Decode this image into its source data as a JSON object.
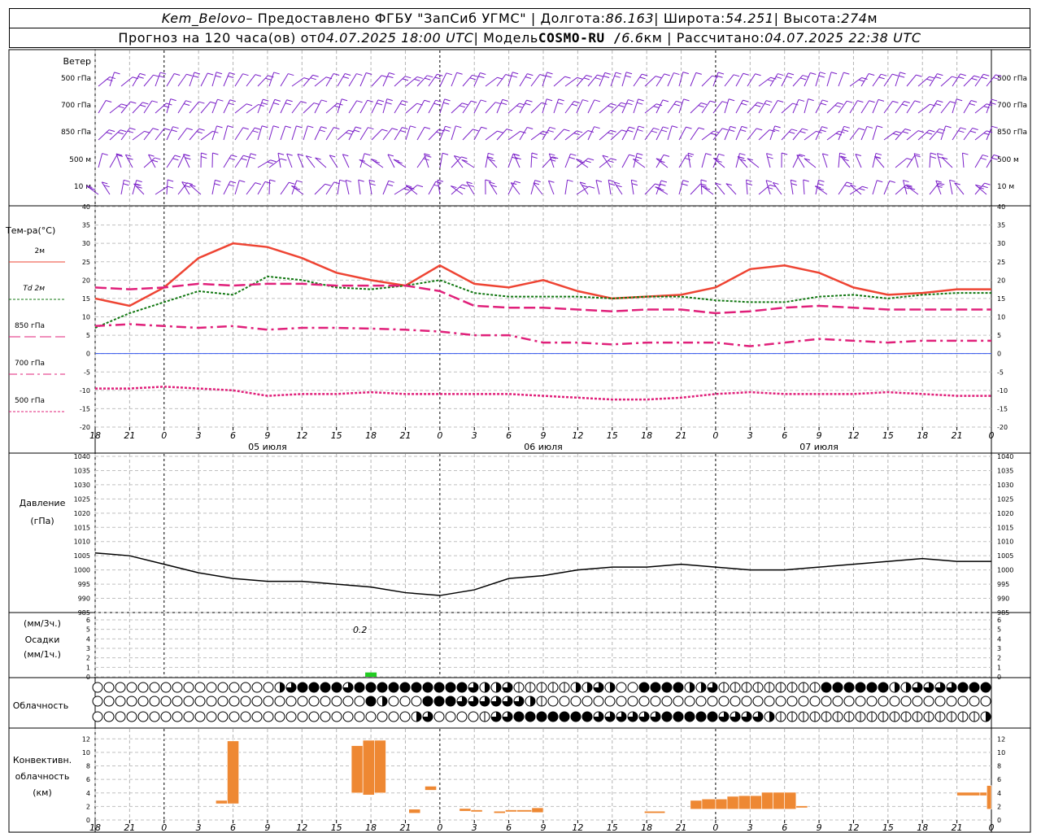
{
  "header": {
    "row1": {
      "station": "Kem_Belovo",
      "provided_by": " – Предоставлено ФГБУ \"ЗапСиб УГМС\" | Долгота: ",
      "lon": "86.163",
      "lat_label": " | Широта: ",
      "lat": "54.251",
      "alt_label": " | Высота: ",
      "alt": "274",
      "alt_unit": "м"
    },
    "row2": {
      "forecast_label": "Прогноз на 120 часа(ов) от ",
      "forecast_from": "04.07.2025 18:00 UTC",
      "model_label": "  | Модель ",
      "model_name": "COSMO-RU / ",
      "model_res": "6.6",
      "model_unit": "км | Рассчитано: ",
      "computed": "04.07.2025 22:38 UTC"
    }
  },
  "chart_data": [
    {
      "type": "wind-barbs",
      "title": "Ветер",
      "levels": [
        "500 гПа",
        "700 гПа",
        "850 гПа",
        "500 м",
        "10 м"
      ],
      "color": "#7a1fc8"
    },
    {
      "type": "line",
      "ylabel": "Тем-ра(°C)",
      "ylim": [
        -20,
        40
      ],
      "yticks": [
        -20,
        -15,
        -10,
        -5,
        0,
        5,
        10,
        15,
        20,
        25,
        30,
        35,
        40
      ],
      "legend": [
        {
          "label": "2м",
          "color": "#ee4433"
        },
        {
          "label": "Td  2м",
          "color": "#117711"
        },
        {
          "label": "850 гПа",
          "color": "#e0207a"
        },
        {
          "label": "700 гПа",
          "color": "#e0207a"
        },
        {
          "label": "500 гПа",
          "color": "#e0207a"
        }
      ],
      "x_hours": [
        0,
        3,
        6,
        9,
        12,
        15,
        18,
        21,
        24,
        27,
        30,
        33,
        36,
        39,
        42,
        45,
        48,
        51,
        54,
        57,
        60,
        63,
        66,
        69,
        72,
        75,
        78
      ],
      "series": [
        {
          "name": "2м",
          "color": "#ee4433",
          "values": [
            15,
            13,
            18,
            26,
            30,
            29,
            26,
            22,
            20,
            18.5,
            24,
            19,
            18,
            20,
            17,
            15,
            15.5,
            16,
            18,
            23,
            24,
            22,
            18,
            16,
            16.5,
            17.5,
            17.5
          ]
        },
        {
          "name": "Td  2м",
          "color": "#117711",
          "values": [
            7,
            11,
            14,
            17,
            16,
            21,
            20,
            18,
            17.5,
            18.5,
            20,
            16.5,
            15.5,
            15.5,
            15.5,
            15,
            15.5,
            15.5,
            14.5,
            14,
            14,
            15.5,
            16,
            15,
            16,
            16.5,
            16.5
          ]
        },
        {
          "name": "850 гПа",
          "color": "#e0207a",
          "values": [
            18,
            17.5,
            18,
            19,
            18.5,
            19,
            19,
            18.5,
            18.5,
            18.5,
            17,
            13,
            12.5,
            12.5,
            12,
            11.5,
            12,
            12,
            11,
            11.5,
            12.5,
            13,
            12.5,
            12,
            12,
            12,
            12
          ]
        },
        {
          "name": "700 гПа",
          "color": "#e0207a",
          "values": [
            7.5,
            8,
            7.5,
            7,
            7.5,
            6.5,
            7,
            7,
            6.8,
            6.5,
            6,
            5,
            5,
            3,
            3,
            2.5,
            3,
            3,
            3,
            2,
            3,
            4,
            3.5,
            3,
            3.5,
            3.5,
            3.5
          ]
        },
        {
          "name": "500 гПа",
          "color": "#e0207a",
          "values": [
            -9.5,
            -9.5,
            -9,
            -9.5,
            -10,
            -11.5,
            -11,
            -11,
            -10.5,
            -11,
            -11,
            -11,
            -11,
            -11.5,
            -12,
            -12.5,
            -12.5,
            -12,
            -11,
            -10.5,
            -11,
            -11,
            -11,
            -10.5,
            -11,
            -11.5,
            -11.5
          ]
        }
      ]
    },
    {
      "type": "line",
      "ylabel": "Давление",
      "yunit": "(гПа)",
      "ylim": [
        985,
        1040
      ],
      "yticks": [
        985,
        990,
        995,
        1000,
        1005,
        1010,
        1015,
        1020,
        1025,
        1030,
        1035,
        1040
      ],
      "x_hours": [
        0,
        3,
        6,
        9,
        12,
        15,
        18,
        21,
        24,
        27,
        30,
        33,
        36,
        39,
        42,
        45,
        48,
        51,
        54,
        57,
        60,
        63,
        66,
        69,
        72,
        75,
        78
      ],
      "series": [
        {
          "name": "",
          "color": "#000000",
          "values": [
            1006,
            1005,
            1002,
            999,
            997,
            996,
            996,
            995,
            994,
            992,
            991,
            993,
            997,
            998,
            1000,
            1001,
            1001,
            1002,
            1001,
            1000,
            1000,
            1001,
            1002,
            1003,
            1004,
            1003,
            1003
          ]
        }
      ]
    },
    {
      "type": "bar",
      "ylabel_top": "(мм/3ч.)",
      "ylabel": "Осадки",
      "ylabel_bottom": "(мм/1ч.)",
      "ylim": [
        0,
        6
      ],
      "yticks": [
        0,
        1,
        2,
        3,
        4,
        5,
        6
      ],
      "annotation": "0.2",
      "bars": [
        {
          "hour": 24,
          "value": 0.2
        }
      ]
    },
    {
      "type": "table",
      "label": "Облачность",
      "rows": [
        "000000000000000000000000000000000000000000000000000000000000000000000000000000000000000000000000000000000000000000000000000000000000000000000000000000000000000000000000000000000000",
        "000000000000000000000000000000000000000000000000000000000000000000000000000000000000000000000000000000000000000000000000000000000000000000000000000000000000000000000000000000000000",
        "000000000000000000000000000000000000000000000000000000000000000000000000000000000000000000000000000000000000000000000000000000000000000000000000000000000000000000000000000000000000"
      ],
      "levels_hours": [
        [
          0,
          0,
          0,
          0,
          0,
          0,
          0,
          0,
          0,
          0,
          0,
          0,
          0,
          0,
          0,
          0,
          2,
          3,
          4,
          4,
          4,
          4,
          3,
          4,
          4,
          4,
          4,
          4,
          4,
          4,
          4,
          4,
          4,
          3,
          2,
          2,
          3,
          1,
          1,
          1,
          1,
          1,
          2,
          2,
          3,
          2,
          0,
          0,
          4,
          4,
          4,
          4,
          2,
          2,
          3,
          1,
          1,
          1,
          1,
          1,
          1,
          1,
          1,
          1,
          4,
          4,
          4,
          4,
          4,
          4,
          2,
          2,
          3,
          3,
          3,
          3,
          4,
          4,
          4,
          4,
          4,
          4,
          4,
          3,
          3,
          4,
          4
        ],
        [
          0,
          0,
          0,
          0,
          0,
          0,
          0,
          0,
          0,
          0,
          0,
          0,
          0,
          0,
          0,
          0,
          0,
          0,
          0,
          0,
          0,
          0,
          0,
          0,
          4,
          2,
          0,
          0,
          0,
          4,
          4,
          4,
          3,
          3,
          3,
          3,
          3,
          3,
          2,
          1,
          0,
          0,
          0,
          0,
          0,
          0,
          0,
          0,
          0,
          0,
          0,
          0,
          0,
          0,
          0,
          0,
          0,
          0,
          0,
          0,
          0,
          0,
          0,
          0,
          0,
          0,
          0,
          0,
          0,
          0,
          0,
          0,
          0,
          0,
          0,
          0,
          0,
          0,
          0,
          0,
          0,
          0,
          0,
          0,
          0,
          0,
          0
        ],
        [
          0,
          0,
          0,
          0,
          0,
          0,
          0,
          0,
          0,
          0,
          0,
          0,
          0,
          0,
          0,
          0,
          0,
          0,
          0,
          0,
          0,
          0,
          0,
          0,
          0,
          0,
          0,
          0,
          2,
          3,
          0,
          0,
          0,
          0,
          1,
          3,
          3,
          4,
          4,
          4,
          4,
          4,
          4,
          4,
          3,
          3,
          3,
          3,
          3,
          3,
          4,
          4,
          4,
          4,
          4,
          3,
          3,
          3,
          3,
          2,
          1,
          1,
          1,
          1,
          1,
          1,
          1,
          1,
          1,
          1,
          1,
          1,
          1,
          1,
          1,
          1,
          1,
          1,
          2,
          2,
          2,
          3,
          3,
          3,
          3,
          3,
          3
        ]
      ]
    },
    {
      "type": "bar",
      "ylabel_top": "Конвективн.",
      "ylabel": "облачность",
      "ylabel_bottom": "(км)",
      "ylim": [
        0,
        13
      ],
      "yticks": [
        0,
        2,
        4,
        6,
        8,
        10,
        12
      ],
      "ranges": [
        {
          "h0": 10.5,
          "h1": 11.5,
          "bottom": 2.4,
          "top": 2.9
        },
        {
          "h0": 11.5,
          "h1": 12.5,
          "bottom": 2.4,
          "top": 11.7
        },
        {
          "h0": 22.3,
          "h1": 23.3,
          "bottom": 4.0,
          "top": 11.0
        },
        {
          "h0": 23.3,
          "h1": 24.3,
          "bottom": 3.7,
          "top": 11.8
        },
        {
          "h0": 24.3,
          "h1": 25.3,
          "bottom": 4.0,
          "top": 11.8
        },
        {
          "h0": 27.3,
          "h1": 28.3,
          "bottom": 1.0,
          "top": 1.6
        },
        {
          "h0": 28.7,
          "h1": 29.7,
          "bottom": 4.4,
          "top": 5.0
        },
        {
          "h0": 31.7,
          "h1": 32.7,
          "bottom": 1.3,
          "top": 1.7
        },
        {
          "h0": 32.7,
          "h1": 33.7,
          "bottom": 1.2,
          "top": 1.5
        },
        {
          "h0": 34.7,
          "h1": 35.7,
          "bottom": 1.0,
          "top": 1.3
        },
        {
          "h0": 35.7,
          "h1": 36.7,
          "bottom": 1.2,
          "top": 1.5
        },
        {
          "h0": 36.7,
          "h1": 38.0,
          "bottom": 1.2,
          "top": 1.5
        },
        {
          "h0": 38.0,
          "h1": 39.0,
          "bottom": 1.1,
          "top": 1.8
        },
        {
          "h0": 47.8,
          "h1": 49.6,
          "bottom": 1.0,
          "top": 1.3
        },
        {
          "h0": 51.8,
          "h1": 52.8,
          "bottom": 1.6,
          "top": 2.9
        },
        {
          "h0": 52.8,
          "h1": 54.0,
          "bottom": 1.6,
          "top": 3.1
        },
        {
          "h0": 54.0,
          "h1": 55.0,
          "bottom": 1.6,
          "top": 3.1
        },
        {
          "h0": 55.0,
          "h1": 56.0,
          "bottom": 1.6,
          "top": 3.5
        },
        {
          "h0": 56.0,
          "h1": 57.0,
          "bottom": 1.6,
          "top": 3.6
        },
        {
          "h0": 57.0,
          "h1": 58.0,
          "bottom": 1.6,
          "top": 3.6
        },
        {
          "h0": 58.0,
          "h1": 59.0,
          "bottom": 1.6,
          "top": 4.1
        },
        {
          "h0": 59.0,
          "h1": 60.0,
          "bottom": 1.6,
          "top": 4.1
        },
        {
          "h0": 60.0,
          "h1": 61.0,
          "bottom": 1.6,
          "top": 4.1
        },
        {
          "h0": 61.0,
          "h1": 62.0,
          "bottom": 1.8,
          "top": 2.1
        },
        {
          "h0": 75.0,
          "h1": 77.0,
          "bottom": 3.6,
          "top": 4.1
        },
        {
          "h0": 77.0,
          "h1": 77.6,
          "bottom": 3.6,
          "top": 4.1
        },
        {
          "h0": 77.6,
          "h1": 78.0,
          "bottom": 1.6,
          "top": 5.1
        }
      ]
    },
    {
      "type": "axis",
      "hour_ticks": [
        "18",
        "21",
        "0",
        "3",
        "6",
        "9",
        "12",
        "15",
        "18",
        "21",
        "0",
        "3",
        "6",
        "9",
        "12",
        "15",
        "18",
        "21",
        "0",
        "3",
        "6",
        "9",
        "12",
        "15",
        "18",
        "21",
        "0"
      ],
      "day_labels": [
        "05 июля",
        "06 июля",
        "07 июля"
      ]
    }
  ]
}
